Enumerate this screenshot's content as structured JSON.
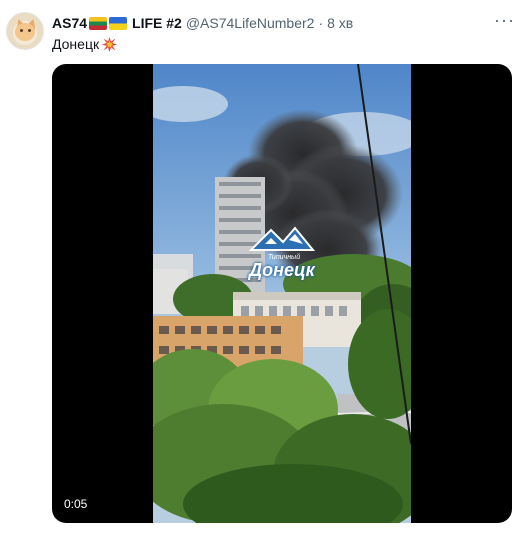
{
  "tweet": {
    "display_name": "AS74",
    "name_suffix": "LIFE #2",
    "handle": "@AS74LifeNumber2",
    "separator": "·",
    "time": "8 хв",
    "text": "Донецк",
    "more_icon": "more-dots-icon",
    "emoji_icon": "collision-icon"
  },
  "media": {
    "duration": "0:05",
    "watermark_line1": "Типичный",
    "watermark_line2": "Донецк"
  }
}
